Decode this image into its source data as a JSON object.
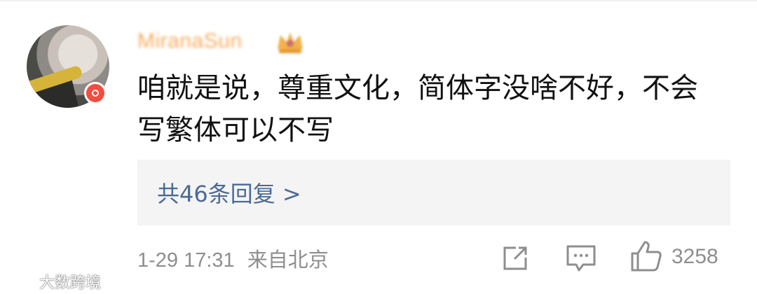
{
  "comment": {
    "username": "MiranaSun",
    "text_line1": "咱就是说，尊重文化，简体字没啥不好，不会",
    "text_line2": "写繁体可以不写",
    "replies_label": "共46条回复 >",
    "date": "1-29 17:31",
    "location": "来自北京",
    "like_count": "3258"
  },
  "icons": {
    "avatar": "user-avatar",
    "badge": "verified-badge-icon",
    "crown": "vip-crown-icon",
    "share": "share-icon",
    "comment": "comment-icon",
    "like": "thumbs-up-icon"
  },
  "colors": {
    "username": "#f7a24a",
    "reply_link": "#4a6a94",
    "meta": "#8e8e8e",
    "badge": "#f24d3f"
  },
  "watermark": {
    "text": "大数跨境"
  }
}
